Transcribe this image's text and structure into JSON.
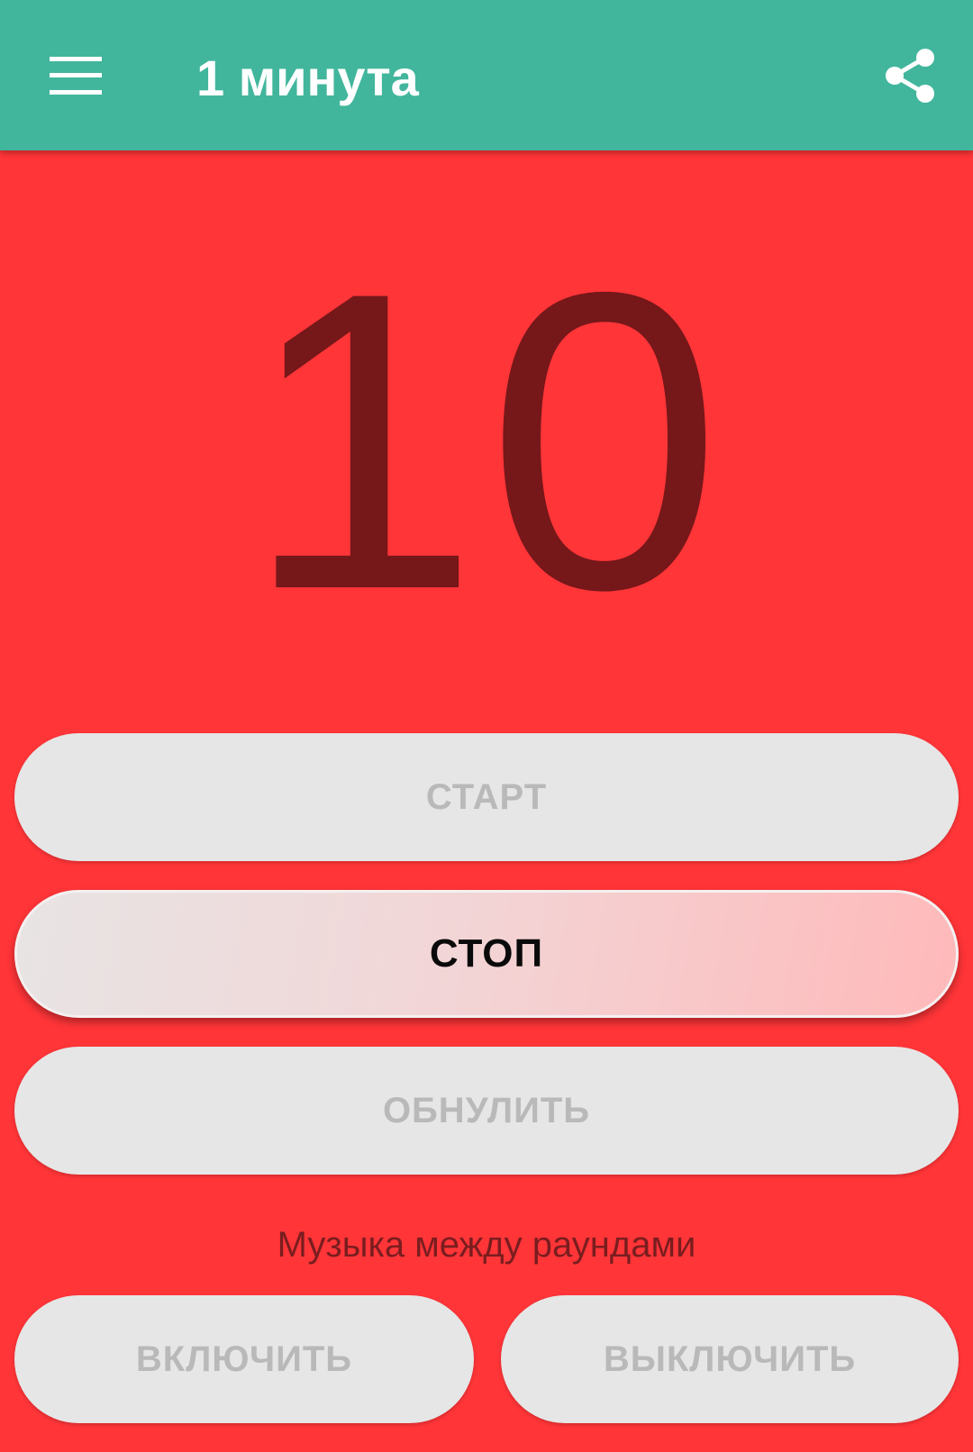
{
  "appbar": {
    "title": "1 минута",
    "menu_icon": "hamburger-menu-icon",
    "share_icon": "share-icon",
    "color": "#42B69C"
  },
  "timer": {
    "value": "10",
    "background_color": "#FF3538",
    "text_color": "#761719"
  },
  "controls": {
    "start_label": "СТАРТ",
    "stop_label": "СТОП",
    "reset_label": "ОБНУЛИТЬ"
  },
  "music": {
    "label": "Музыка между раундами",
    "on_label": "ВКЛЮЧИТЬ",
    "off_label": "ВЫКЛЮЧИТЬ"
  }
}
